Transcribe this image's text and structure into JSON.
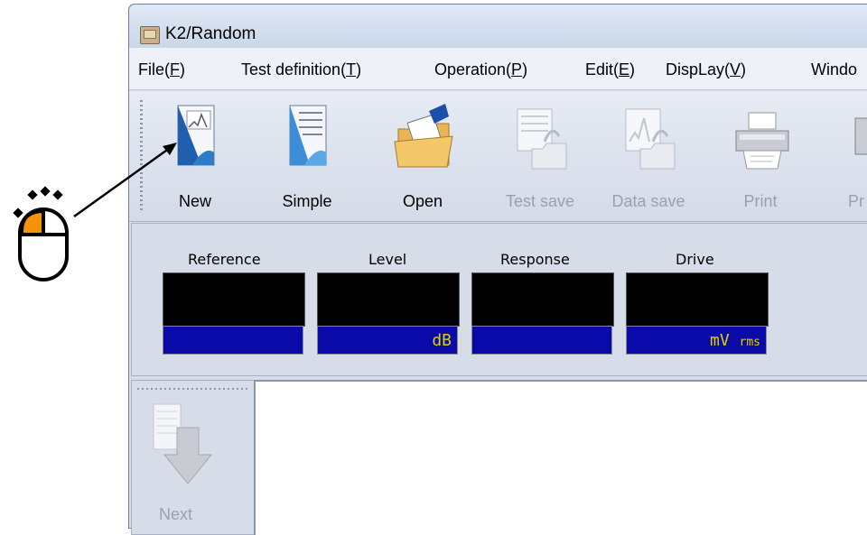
{
  "window": {
    "title": "K2/Random"
  },
  "menu": [
    {
      "text": "File(",
      "key": "F",
      "tail": ")"
    },
    {
      "text": "Test definition(",
      "key": "T",
      "tail": ")"
    },
    {
      "text": "Operation(",
      "key": "P",
      "tail": ")"
    },
    {
      "text": "Edit(",
      "key": "E",
      "tail": ")"
    },
    {
      "text": "DispLay(",
      "key": "V",
      "tail": ")"
    },
    {
      "text": "Windo"
    }
  ],
  "toolbar": {
    "new": "New",
    "simple": "Simple",
    "open": "Open",
    "test_save": "Test save",
    "data_save": "Data save",
    "print": "Print",
    "preview_partial": "Pr"
  },
  "meters": [
    {
      "label": "Reference",
      "unit": ""
    },
    {
      "label": "Level",
      "unit": "dB"
    },
    {
      "label": "Response",
      "unit": ""
    },
    {
      "label": "Drive",
      "unit": "mV",
      "unit_small": "rms"
    }
  ],
  "side": {
    "next": "Next"
  },
  "colors": {
    "accent_mouse": "#f5920a",
    "meter_bg": "#0a0aa8",
    "meter_text": "#e0d000"
  }
}
